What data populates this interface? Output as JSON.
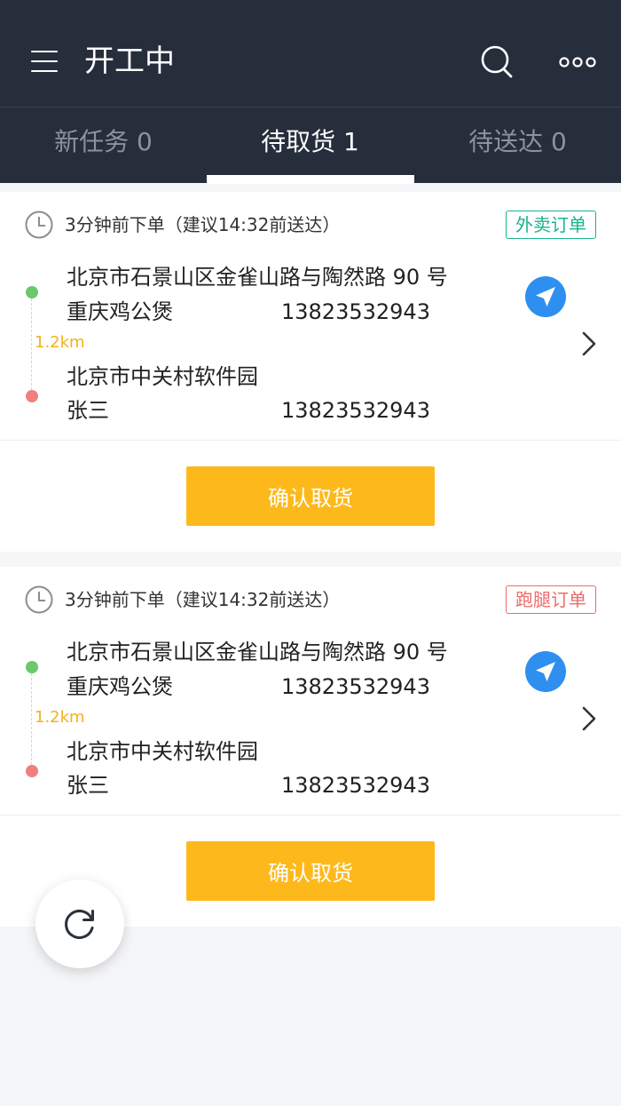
{
  "header": {
    "title": "开工中",
    "menu_icon": "menu-icon",
    "search_icon": "search-icon",
    "more_icon": "more-icon"
  },
  "tabs": [
    {
      "label": "新任务 0",
      "active": false
    },
    {
      "label": "待取货 1",
      "active": true
    },
    {
      "label": "待送达 0",
      "active": false
    }
  ],
  "orders": [
    {
      "time_text": "3分钟前下单（建议14:32前送达）",
      "tag": "外卖订单",
      "tag_color": "#19b48a",
      "from": {
        "address": "北京市石景山区金雀山路与陶然路 90 号",
        "name": "重庆鸡公煲",
        "phone": "13823532943"
      },
      "distance": "1.2km",
      "to": {
        "address": "北京市中关村软件园",
        "name": "张三",
        "phone": "13823532943"
      },
      "button_label": "确认取货"
    },
    {
      "time_text": "3分钟前下单（建议14:32前送达）",
      "tag": "跑腿订单",
      "tag_color": "#ef6b6b",
      "from": {
        "address": "北京市石景山区金雀山路与陶然路 90 号",
        "name": "重庆鸡公煲",
        "phone": "13823532943"
      },
      "distance": "1.2km",
      "to": {
        "address": "北京市中关村软件园",
        "name": "张三",
        "phone": "13823532943"
      },
      "button_label": "确认取货"
    }
  ],
  "colors": {
    "header_bg": "#262d3b",
    "accent": "#fdb91c",
    "navigation_blue": "#2f8ff0",
    "distance_text": "#f5b01a",
    "origin_dot": "#6cc86c",
    "destination_dot": "#f08080"
  },
  "fab": {
    "icon": "refresh-icon"
  }
}
